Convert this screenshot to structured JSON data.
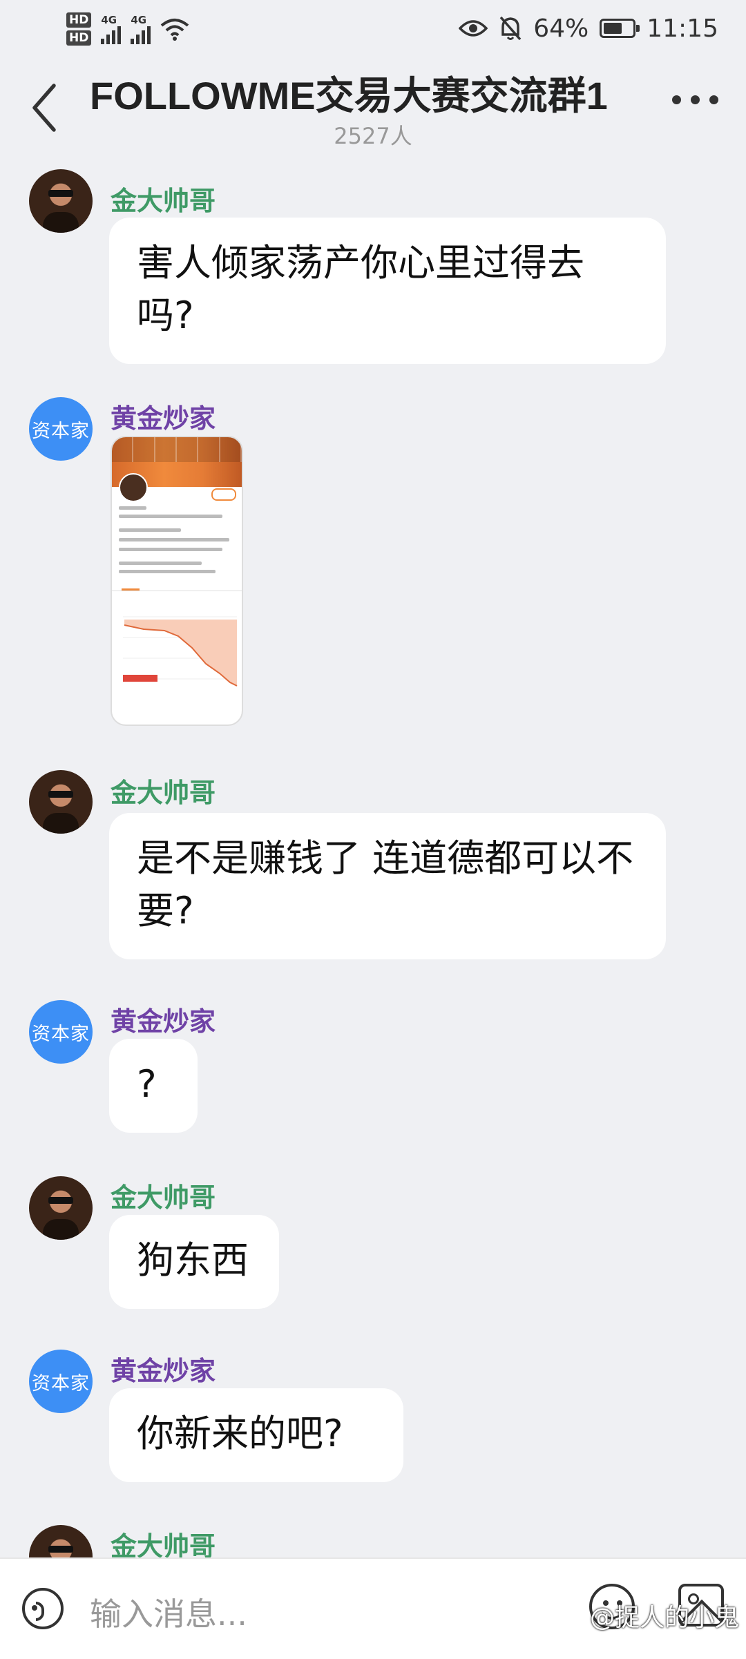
{
  "status_bar": {
    "hd1": "HD",
    "hd2": "HD",
    "sim1_label": "4G",
    "sim2_label": "4G",
    "battery_percent_text": "64%",
    "battery_level": 0.64,
    "time": "11:15",
    "icons": [
      "eye-icon",
      "bell-off-icon",
      "wifi-icon",
      "battery-icon"
    ]
  },
  "header": {
    "title": "FOLLOWME交易大赛交流群1",
    "members": "2527人"
  },
  "messages": [
    {
      "sender": "金大帅哥",
      "text": "害人倾家荡产你心里过得去吗?"
    },
    {
      "sender": "黄金炒家",
      "avatar_text": "资本家",
      "image": "profile-screenshot"
    },
    {
      "sender": "金大帅哥",
      "text": "是不是赚钱了  连道德都可以不要?"
    },
    {
      "sender": "黄金炒家",
      "avatar_text": "资本家",
      "text": "?"
    },
    {
      "sender": "金大帅哥",
      "text": "狗东西"
    },
    {
      "sender": "黄金炒家",
      "avatar_text": "资本家",
      "text": "你新来的吧?"
    },
    {
      "sender": "金大帅哥"
    }
  ],
  "input": {
    "placeholder": "输入消息..."
  },
  "watermark": "@捉人的小鬼",
  "colors": {
    "green_name": "#3f9a66",
    "purple_name": "#6f42a6",
    "avatar_blue": "#3d8ff5",
    "background": "#eff0f3"
  }
}
